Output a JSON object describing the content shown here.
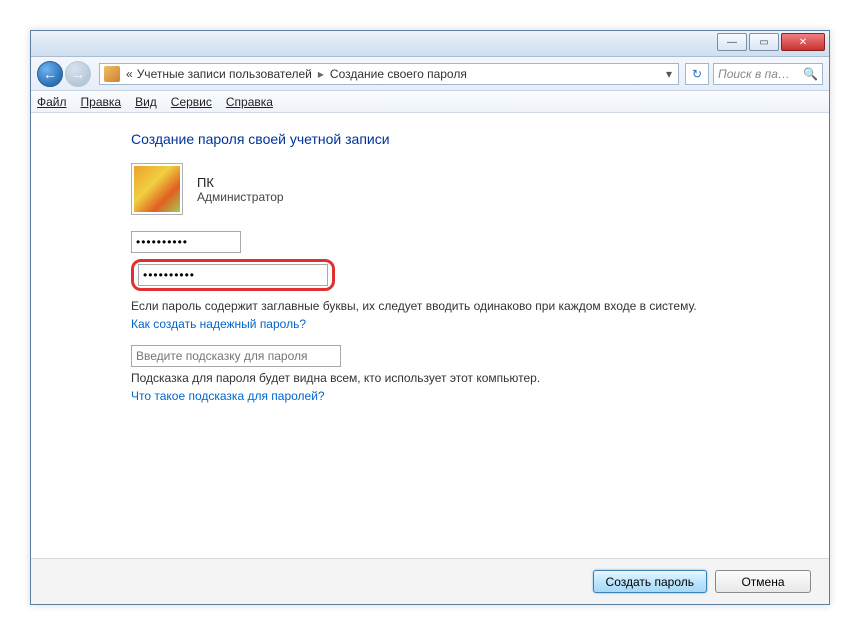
{
  "titlebar": {
    "minimize": "—",
    "maximize": "▭",
    "close": "✕"
  },
  "nav": {
    "back": "←",
    "forward": "→",
    "breadcrumb_prefix": "«",
    "breadcrumb1": "Учетные записи пользователей",
    "breadcrumb2": "Создание своего пароля",
    "chevron": "▸",
    "dropdown": "▾",
    "refresh": "↻",
    "search_placeholder": "Поиск в па…",
    "search_icon": "🔍"
  },
  "menu": {
    "file": "Файл",
    "edit": "Правка",
    "view": "Вид",
    "service": "Сервис",
    "help": "Справка"
  },
  "page": {
    "heading": "Создание пароля своей учетной записи",
    "username": "ПК",
    "role": "Администратор",
    "pw1_value": "••••••••••",
    "pw2_value": "••••••••••",
    "caps_note": "Если пароль содержит заглавные буквы, их следует вводить одинаково при каждом входе в систему.",
    "strong_pw_link": "Как создать надежный пароль?",
    "hint_placeholder": "Введите подсказку для пароля",
    "hint_note": "Подсказка для пароля будет видна всем, кто использует этот компьютер.",
    "hint_link": "Что такое подсказка для паролей?"
  },
  "footer": {
    "create": "Создать пароль",
    "cancel": "Отмена"
  }
}
